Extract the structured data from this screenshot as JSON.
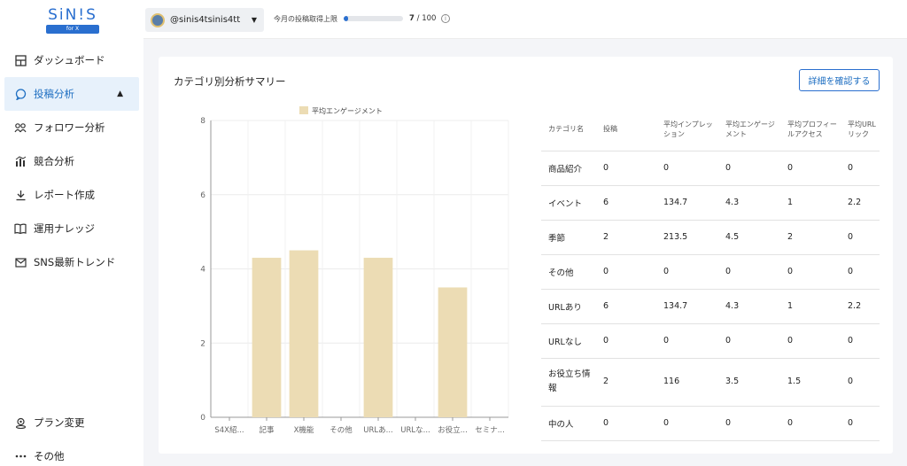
{
  "brand": {
    "logo": "SiN!S",
    "logo_sub": "for X"
  },
  "sidebar": {
    "items": [
      {
        "label": "ダッシュボード",
        "icon": "dashboard-icon"
      },
      {
        "label": "投稿分析",
        "icon": "chat-bubble-icon",
        "active": true
      },
      {
        "label": "フォロワー分析",
        "icon": "users-icon"
      },
      {
        "label": "競合分析",
        "icon": "bar-chart-icon"
      },
      {
        "label": "レポート作成",
        "icon": "download-icon"
      },
      {
        "label": "運用ナレッジ",
        "icon": "book-icon"
      },
      {
        "label": "SNS最新トレンド",
        "icon": "mail-icon"
      }
    ],
    "bottom": [
      {
        "label": "プラン変更",
        "icon": "location-pin-icon"
      },
      {
        "label": "その他",
        "icon": "more-icon"
      }
    ]
  },
  "topbar": {
    "account": "@sinis4tsinis4tt",
    "quota_label": "今月の投稿取得上限",
    "quota_used": "7",
    "quota_total": "100",
    "quota_fraction": 0.07
  },
  "card": {
    "title": "カテゴリ別分析サマリー",
    "detail_button": "詳細を確認する"
  },
  "chart_data": {
    "type": "bar",
    "legend": "平均エンゲージメント",
    "categories": [
      "S4X紹...",
      "記事",
      "X機能",
      "その他",
      "URLあ...",
      "URLな...",
      "お役立...",
      "セミナ..."
    ],
    "values": [
      0,
      4.3,
      4.5,
      0,
      4.3,
      0,
      3.5,
      0
    ],
    "ylim": [
      0,
      8
    ],
    "yticks": [
      "0",
      "2",
      "4",
      "6",
      "8"
    ],
    "bar_color": "#ecdcb4",
    "grid": true
  },
  "table": {
    "headers": [
      "カテゴリ名",
      "投稿",
      "平均インプレッション",
      "平均エンゲージメント",
      "平均プロフィールアクセス",
      "平均URLリック"
    ],
    "rows": [
      [
        "商品紹介",
        "0",
        "0",
        "0",
        "0",
        "0"
      ],
      [
        "イベント",
        "6",
        "134.7",
        "4.3",
        "1",
        "2.2"
      ],
      [
        "季節",
        "2",
        "213.5",
        "4.5",
        "2",
        "0"
      ],
      [
        "その他",
        "0",
        "0",
        "0",
        "0",
        "0"
      ],
      [
        "URLあり",
        "6",
        "134.7",
        "4.3",
        "1",
        "2.2"
      ],
      [
        "URLなし",
        "0",
        "0",
        "0",
        "0",
        "0"
      ],
      [
        "お役立ち情報",
        "2",
        "116",
        "3.5",
        "1.5",
        "0"
      ],
      [
        "中の人",
        "0",
        "0",
        "0",
        "0",
        "0"
      ]
    ]
  },
  "colors": {
    "accent": "#2a6fcf",
    "active_bg": "#e7f1fb"
  }
}
